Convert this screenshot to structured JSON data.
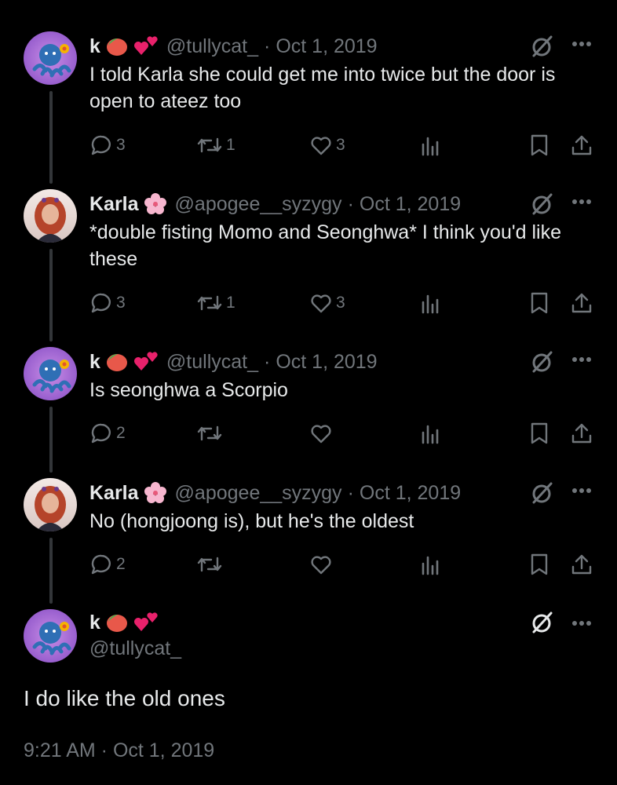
{
  "colors": {
    "background": "#000000",
    "text": "#e7e9ea",
    "muted": "#71767b",
    "thread_line": "#333639"
  },
  "replies": [
    {
      "name": "k",
      "handle": "@tullycat_",
      "sep": "·",
      "date": "Oct 1, 2019",
      "text": "I told Karla she could get me into twice but the door is open to ateez too",
      "replies": "3",
      "retweets": "1",
      "likes": "3",
      "avatar": "octopus-avatar",
      "emojis": [
        "mango-emoji",
        "two-hearts-emoji"
      ]
    },
    {
      "name": "Karla",
      "handle": "@apogee__syzygy",
      "sep": "·",
      "date": "Oct 1, 2019",
      "text": "*double fisting Momo and Seonghwa* I think you'd like these",
      "replies": "3",
      "retweets": "1",
      "likes": "3",
      "avatar": "portrait-avatar",
      "emojis": [
        "cherry-blossom-emoji"
      ]
    },
    {
      "name": "k",
      "handle": "@tullycat_",
      "sep": "·",
      "date": "Oct 1, 2019",
      "text": "Is seonghwa a Scorpio",
      "replies": "2",
      "retweets": "",
      "likes": "",
      "avatar": "octopus-avatar",
      "emojis": [
        "mango-emoji",
        "two-hearts-emoji"
      ]
    },
    {
      "name": "Karla",
      "handle": "@apogee__syzygy",
      "sep": "·",
      "date": "Oct 1, 2019",
      "text": "No (hongjoong is), but he's the oldest",
      "replies": "2",
      "retweets": "",
      "likes": "",
      "avatar": "portrait-avatar",
      "emojis": [
        "cherry-blossom-emoji"
      ]
    }
  ],
  "main_tweet": {
    "name": "k",
    "handle": "@tullycat_",
    "text": "I do like the old ones",
    "timestamp": "9:21 AM · Oct 1, 2019",
    "avatar": "octopus-avatar",
    "emojis": [
      "mango-emoji",
      "two-hearts-emoji"
    ]
  }
}
